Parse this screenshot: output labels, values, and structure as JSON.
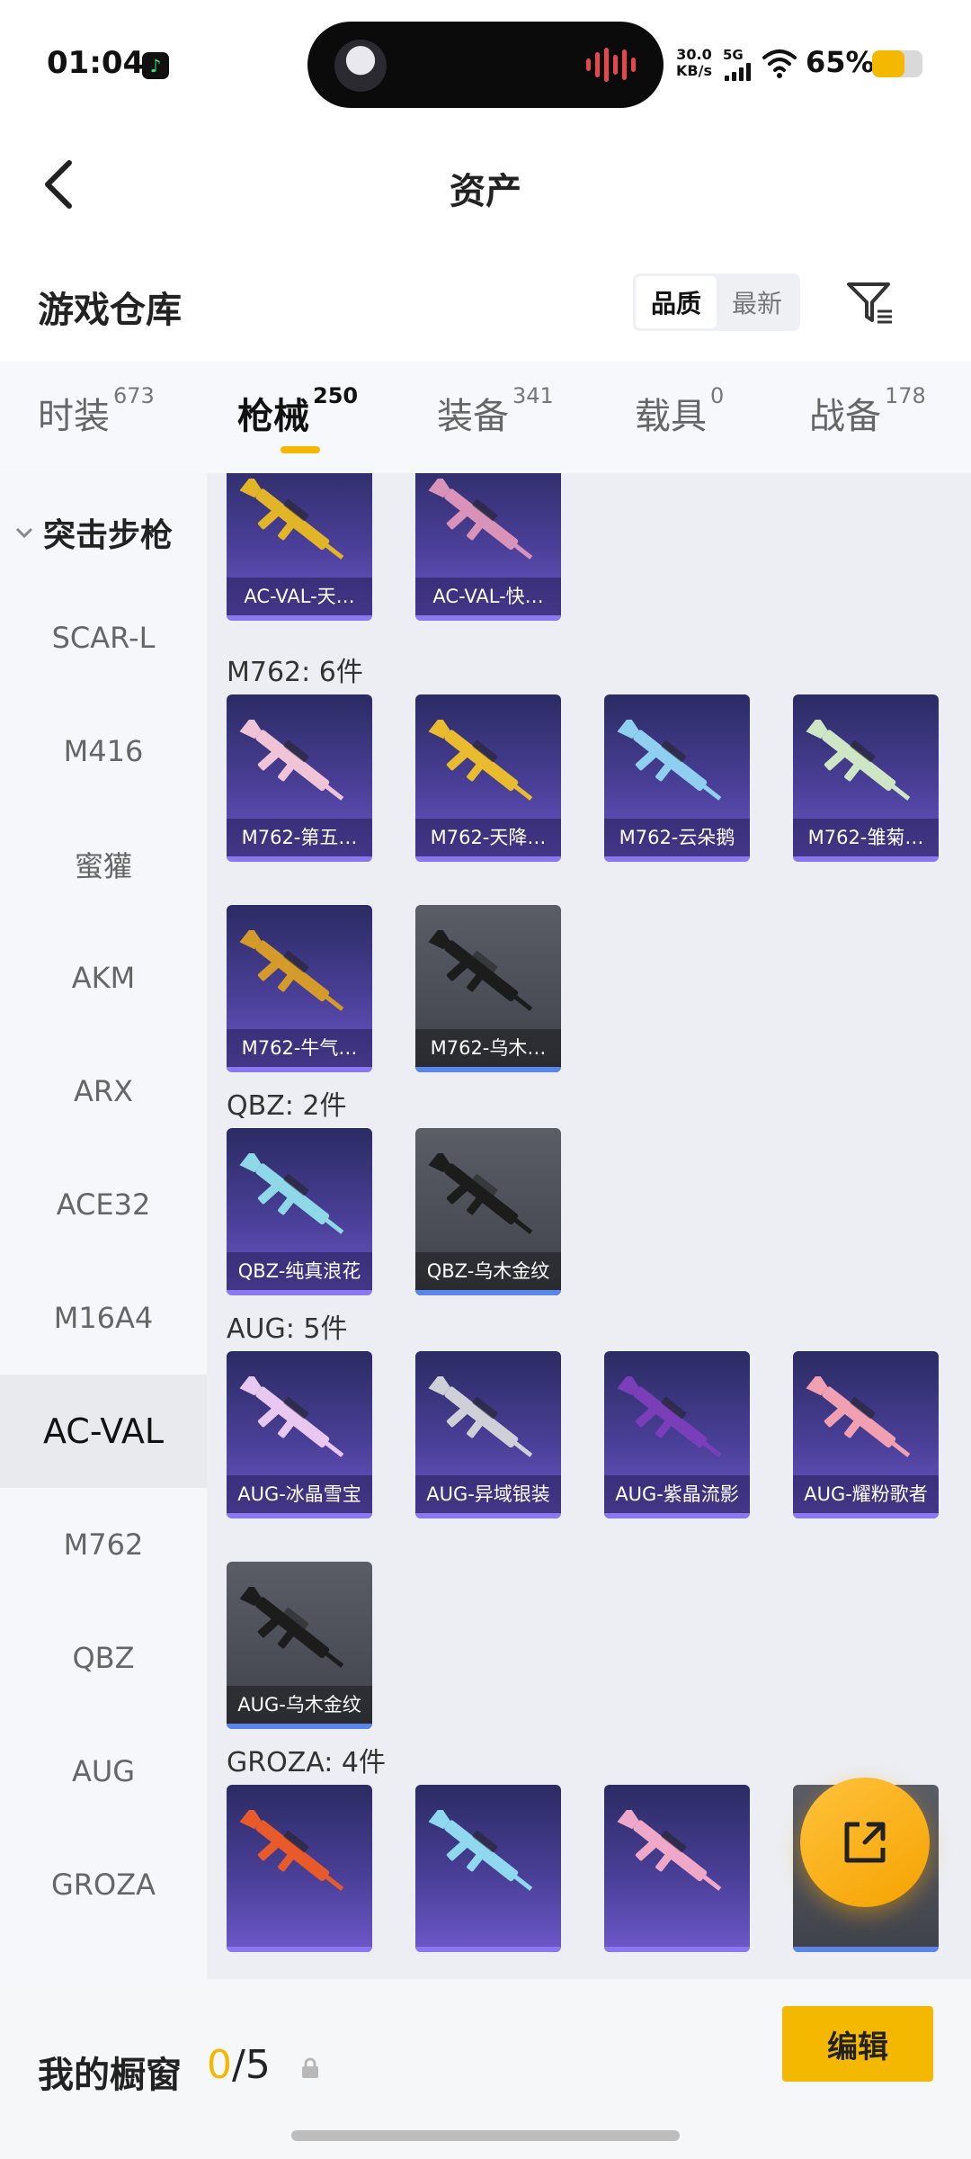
{
  "status_bar": {
    "time": "01:04",
    "network_speed_value": "30.0",
    "network_speed_unit": "KB/s",
    "network_type": "5G",
    "battery_text": "65%",
    "battery_level": 0.65,
    "accent_color": "#f5b800"
  },
  "header": {
    "title": "资产",
    "back_icon": "chevron-left-icon"
  },
  "warehouse": {
    "title": "游戏仓库",
    "sort_options": [
      "品质",
      "最新"
    ],
    "sort_selected": "品质",
    "filter_icon": "filter-icon"
  },
  "tabs": [
    {
      "label": "时装",
      "count": "673"
    },
    {
      "label": "枪械",
      "count": "250"
    },
    {
      "label": "装备",
      "count": "341"
    },
    {
      "label": "载具",
      "count": "0"
    },
    {
      "label": "战备",
      "count": "178"
    }
  ],
  "active_tab": "枪械",
  "sidebar": {
    "header": "突击步枪",
    "items": [
      "SCAR-L",
      "M416",
      "蜜獾",
      "AKM",
      "ARX",
      "ACE32",
      "M16A4",
      "AC-VAL",
      "M762",
      "QBZ",
      "AUG",
      "GROZA"
    ],
    "active": "AC-VAL"
  },
  "groups": [
    {
      "label": "",
      "items": [
        {
          "name": "AC-VAL-天…",
          "style": "purple",
          "gun_color": "#e2b428"
        },
        {
          "name": "AC-VAL-快…",
          "style": "purple",
          "gun_color": "#d992b8"
        }
      ]
    },
    {
      "label": "M762: 6件",
      "items": [
        {
          "name": "M762-第五…",
          "style": "purple",
          "gun_color": "#f0c4d6"
        },
        {
          "name": "M762-天降…",
          "style": "purple",
          "gun_color": "#e8bc2e"
        },
        {
          "name": "M762-云朵鹅",
          "style": "purple",
          "gun_color": "#8fd0f0"
        },
        {
          "name": "M762-雏菊…",
          "style": "purple",
          "gun_color": "#cfe6c4"
        },
        {
          "name": "M762-牛气…",
          "style": "purple",
          "gun_color": "#d49a2a"
        },
        {
          "name": "M762-乌木…",
          "style": "gray",
          "gun_color": "#1c1c1c"
        }
      ]
    },
    {
      "label": "QBZ: 2件",
      "items": [
        {
          "name": "QBZ-纯真浪花",
          "style": "purple",
          "gun_color": "#8fd8e8"
        },
        {
          "name": "QBZ-乌木金纹",
          "style": "gray",
          "gun_color": "#1c1c1c"
        }
      ]
    },
    {
      "label": "AUG: 5件",
      "items": [
        {
          "name": "AUG-冰晶雪宝",
          "style": "purple",
          "gun_color": "#e8c8f0"
        },
        {
          "name": "AUG-异域银装",
          "style": "purple",
          "gun_color": "#cfcfd8"
        },
        {
          "name": "AUG-紫晶流影",
          "style": "purple",
          "gun_color": "#7a3fb8"
        },
        {
          "name": "AUG-耀粉歌者",
          "style": "purple",
          "gun_color": "#f0a0b0"
        },
        {
          "name": "AUG-乌木金纹",
          "style": "gray",
          "gun_color": "#1c1c1c"
        }
      ]
    },
    {
      "label": "GROZA: 4件",
      "items": [
        {
          "name": "",
          "style": "purple",
          "gun_color": "#e85a2a"
        },
        {
          "name": "",
          "style": "purple",
          "gun_color": "#8fd8f0"
        },
        {
          "name": "",
          "style": "purple",
          "gun_color": "#f0a8c8"
        },
        {
          "name": "",
          "style": "gray",
          "gun_color": "#1c1c1c"
        }
      ]
    }
  ],
  "fab_icon": "share-icon",
  "bottom": {
    "showcase_label": "我的橱窗",
    "count_current": "0",
    "count_total": "/5",
    "lock_icon": "lock-icon",
    "edit_label": "编辑"
  }
}
